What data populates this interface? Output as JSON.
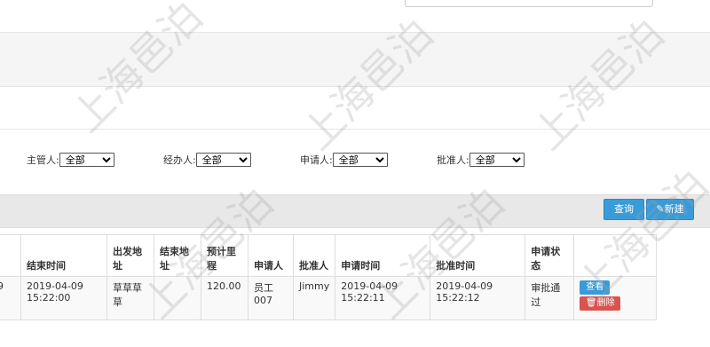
{
  "filters": {
    "supervisor": {
      "label": "主管人:",
      "value": "全部"
    },
    "handler": {
      "label": "经办人:",
      "value": "全部"
    },
    "applicant": {
      "label": "申请人:",
      "value": "全部"
    },
    "approver": {
      "label": "批准人:",
      "value": "全部"
    }
  },
  "toolbar": {
    "query_label": "查询",
    "new_label": "新建"
  },
  "table": {
    "headers": [
      "",
      "结束时间",
      "出发地址",
      "结束地址",
      "预计里程",
      "申请人",
      "批准人",
      "申请时间",
      "批准时间",
      "申请状态",
      ""
    ],
    "row": {
      "c0": "9",
      "end_time": "2019-04-09 15:22:00",
      "from": "草草草草",
      "to": "",
      "mileage": "120.00",
      "applicant": "员工007",
      "approver": "Jimmy",
      "apply_time": "2019-04-09 15:22:11",
      "approve_time": "2019-04-09 15:22:12",
      "status": "审批通过",
      "view_label": "查看",
      "delete_label": "删除"
    }
  },
  "watermark": "上海邑泊"
}
